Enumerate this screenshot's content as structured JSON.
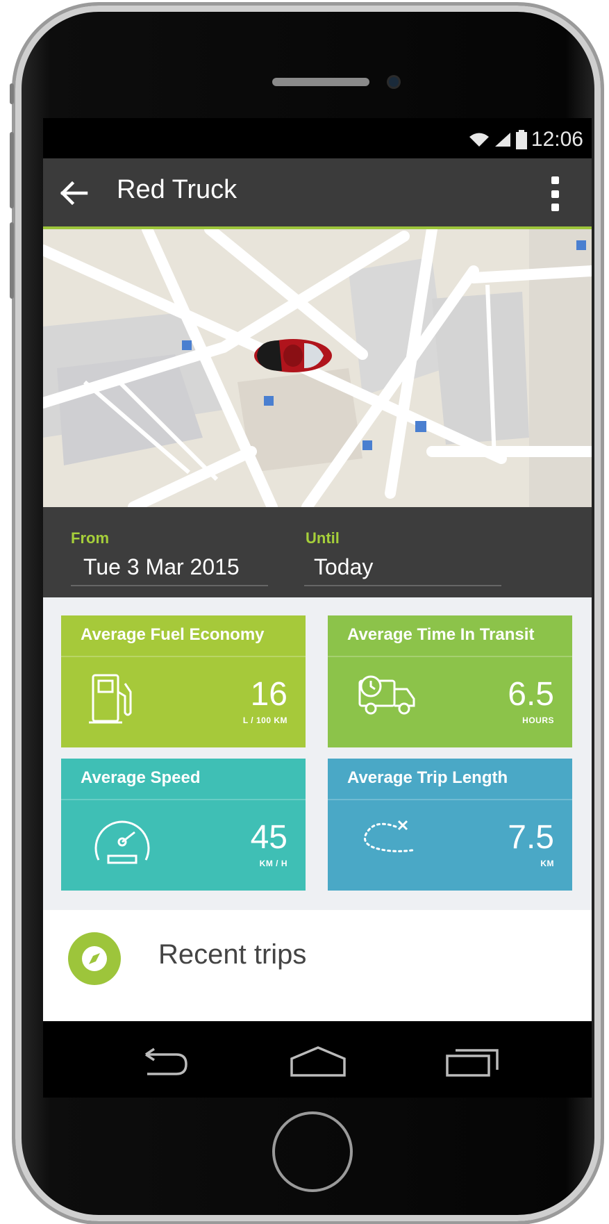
{
  "status": {
    "time": "12:06"
  },
  "appbar": {
    "title": "Red Truck"
  },
  "dates": {
    "from_label": "From",
    "from_value": "Tue 3 Mar 2015",
    "until_label": "Until",
    "until_value": "Today"
  },
  "cards": [
    {
      "title": "Average Fuel Economy",
      "value": "16",
      "unit": "L / 100 KM",
      "icon": "fuel-pump-icon",
      "color": "#a6c93a"
    },
    {
      "title": "Average Time In Transit",
      "value": "6.5",
      "unit": "HOURS",
      "icon": "truck-clock-icon",
      "color": "#8cc34a"
    },
    {
      "title": "Average Speed",
      "value": "45",
      "unit": "KM / H",
      "icon": "speedometer-icon",
      "color": "#3fbfb5"
    },
    {
      "title": "Average Trip Length",
      "value": "7.5",
      "unit": "KM",
      "icon": "route-icon",
      "color": "#4aa8c6"
    }
  ],
  "recent": {
    "label": "Recent trips",
    "icon": "compass-icon",
    "color": "#9dc53b"
  },
  "colors": {
    "accent": "#9dc53b",
    "appbar": "#3b3b3b"
  }
}
